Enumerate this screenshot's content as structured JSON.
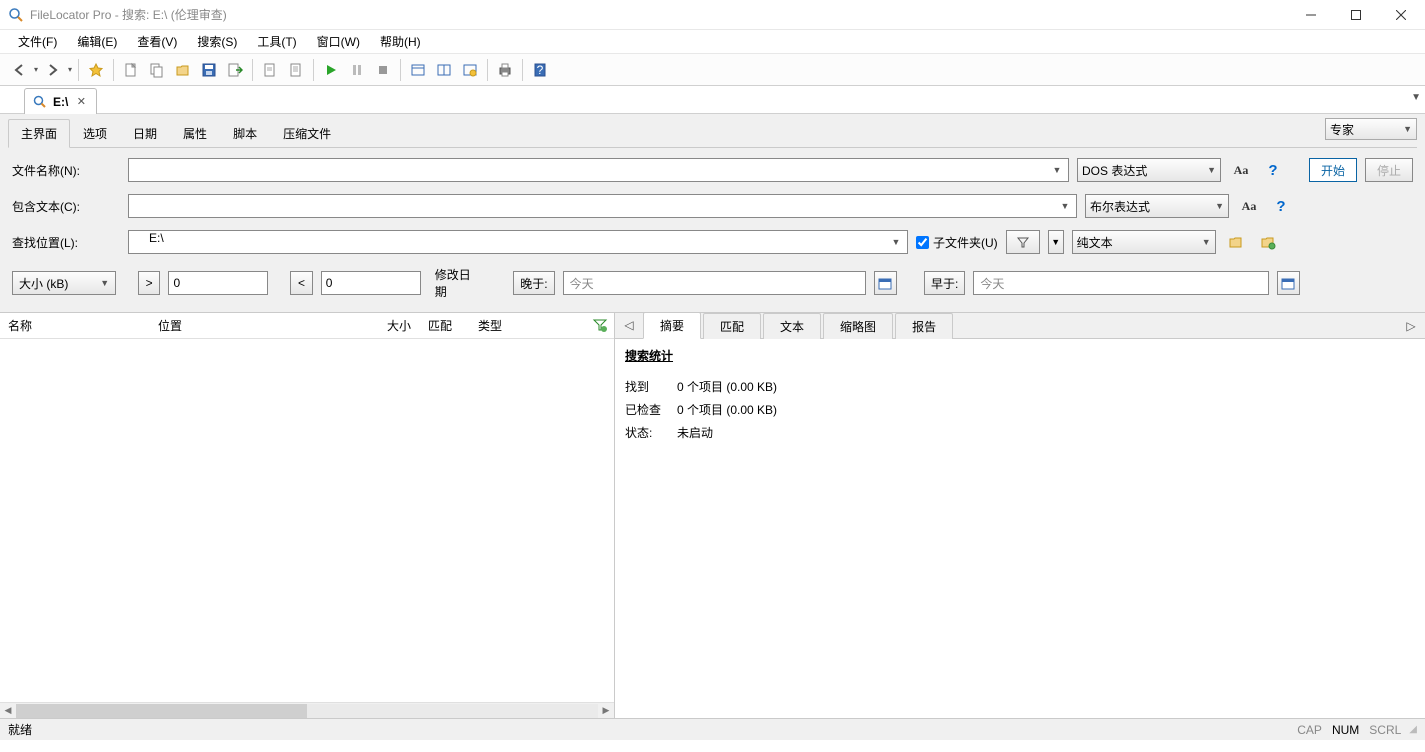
{
  "window": {
    "title": "FileLocator Pro - 搜索: E:\\ (伦理审查)"
  },
  "menu": {
    "file": "文件(F)",
    "edit": "编辑(E)",
    "view": "查看(V)",
    "search": "搜索(S)",
    "tools": "工具(T)",
    "window": "窗口(W)",
    "help": "帮助(H)"
  },
  "doctab": {
    "label": "E:\\"
  },
  "criteria": {
    "tabs": {
      "main": "主界面",
      "options": "选项",
      "date": "日期",
      "attributes": "属性",
      "script": "脚本",
      "archive": "压缩文件"
    },
    "mode_label": "专家",
    "start": "开始",
    "stop": "停止",
    "filename_label": "文件名称(N):",
    "filename_value": "",
    "filename_expr": "DOS 表达式",
    "contains_label": "包含文本(C):",
    "contains_value": "",
    "contains_expr": "布尔表达式",
    "lookin_label": "查找位置(L):",
    "lookin_value": "E:\\",
    "subfolders": "子文件夹(U)",
    "content_type": "纯文本",
    "size_unit": "大小 (kB)",
    "size_gt": ">",
    "size_gt_val": "0",
    "size_lt": "<",
    "size_lt_val": "0",
    "modified_label": "修改日期",
    "after_label": "晚于:",
    "after_value": "今天",
    "before_label": "早于:",
    "before_value": "今天",
    "aa": "Aa",
    "q": "?"
  },
  "results": {
    "cols": {
      "name": "名称",
      "location": "位置",
      "size": "大小",
      "hits": "匹配",
      "type": "类型"
    }
  },
  "detail": {
    "tabs": {
      "summary": "摘要",
      "hits": "匹配",
      "text": "文本",
      "thumb": "缩略图",
      "report": "报告"
    },
    "stats_title": "搜索统计",
    "found_k": "找到",
    "found_v": "0 个项目 (0.00 KB)",
    "checked_k": "已检查",
    "checked_v": "0 个项目 (0.00 KB)",
    "status_k": "状态:",
    "status_v": "未启动"
  },
  "status": {
    "ready": "就绪",
    "cap": "CAP",
    "num": "NUM",
    "scrl": "SCRL"
  }
}
